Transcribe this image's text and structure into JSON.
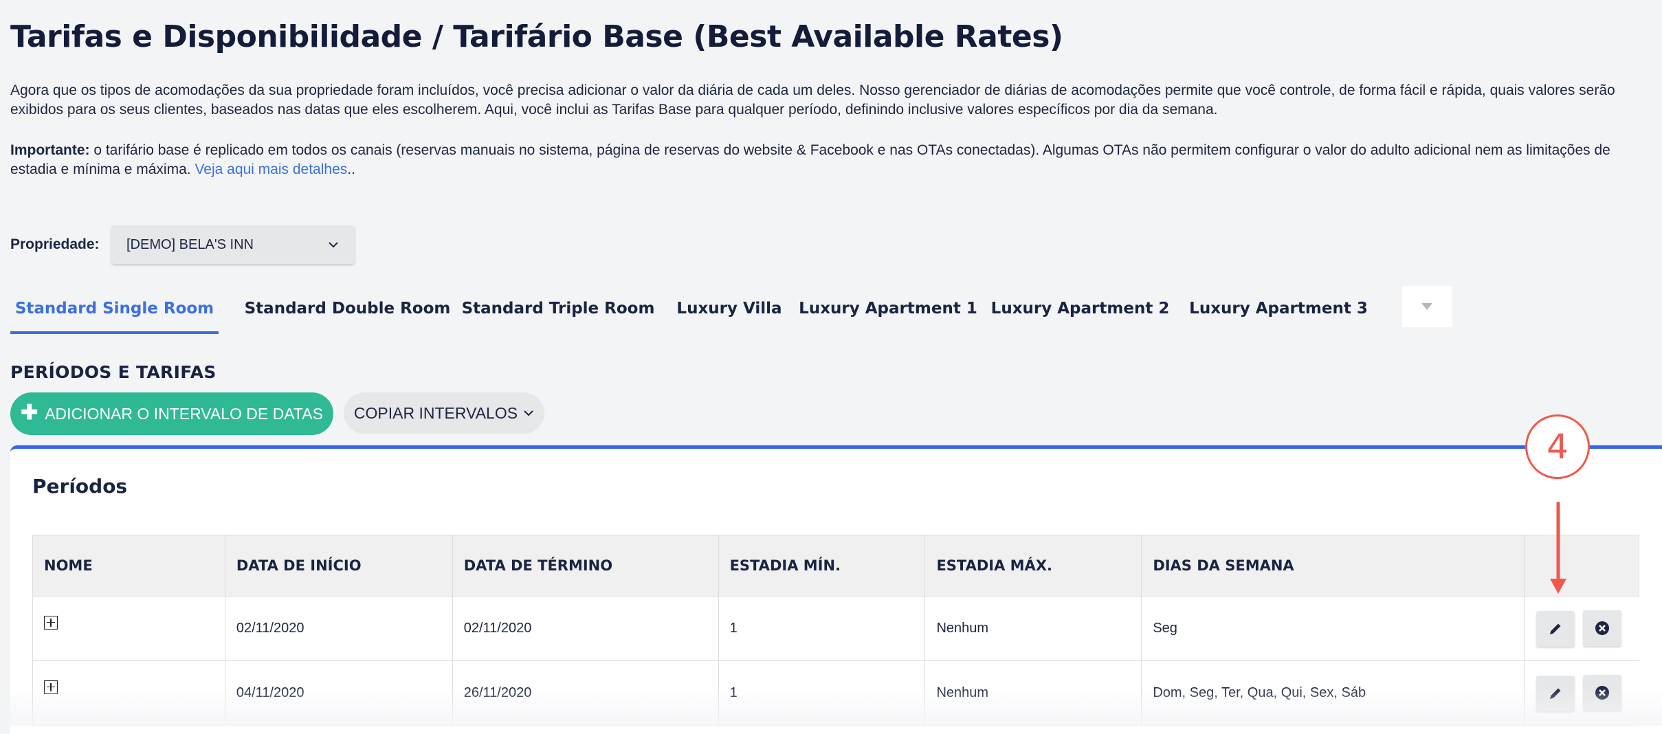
{
  "header": {
    "title": "Tarifas e Disponibilidade  / Tarifário Base (Best Available Rates)",
    "intro": "Agora que os tipos de acomodações da sua propriedade foram incluídos, você precisa adicionar o valor da diária de cada um deles. Nosso gerenciador de diárias de acomodações permite que você controle, de forma fácil e rápida, quais valores serão exibidos para os seus clientes, baseados nas datas que eles escolherem. Aqui, você inclui as Tarifas Base para qualquer período, definindo inclusive valores específicos por dia da semana.",
    "important_label": "Importante:",
    "important_text": " o tarifário base é replicado em todos os canais (reservas manuais no sistema, página de reservas do website & Facebook e nas OTAs conectadas). Algumas OTAs não permitem configurar o valor do adulto adicional nem as limitações de estadia e mínima e máxima. ",
    "details_link": "Veja aqui mais detalhes",
    "details_suffix": ".."
  },
  "property": {
    "label": "Propriedade:",
    "selected": "[DEMO] BELA'S INN"
  },
  "tabs": [
    {
      "label": "Standard Single Room",
      "active": true
    },
    {
      "label": "Standard Double Room",
      "active": false
    },
    {
      "label": "Standard Triple Room",
      "active": false
    },
    {
      "label": "Luxury Villa",
      "active": false
    },
    {
      "label": "Luxury Apartment 1",
      "active": false
    },
    {
      "label": "Luxury Apartment 2",
      "active": false
    },
    {
      "label": "Luxury Apartment 3",
      "active": false
    }
  ],
  "section": {
    "heading": "PERÍODOS E TARIFAS",
    "add_button": "ADICIONAR O INTERVALO DE DATAS",
    "copy_button": "COPIAR INTERVALOS"
  },
  "panel": {
    "title": "Períodos",
    "columns": [
      "NOME",
      "DATA DE INÍCIO",
      "DATA DE TÉRMINO",
      "ESTADIA MÍN.",
      "ESTADIA MÁX.",
      "DIAS DA SEMANA",
      ""
    ],
    "rows": [
      {
        "start": "02/11/2020",
        "end": "02/11/2020",
        "min": "1",
        "max": "Nenhum",
        "days": "Seg"
      },
      {
        "start": "04/11/2020",
        "end": "26/11/2020",
        "min": "1",
        "max": "Nenhum",
        "days": "Dom, Seg, Ter, Qua, Qui, Sex, Sáb"
      }
    ]
  },
  "annotation": {
    "step": "4",
    "color": "#f0584c"
  },
  "colors": {
    "accent": "#3b6fe0",
    "add_button": "#2fb994",
    "panel_border": "#3564e8"
  }
}
